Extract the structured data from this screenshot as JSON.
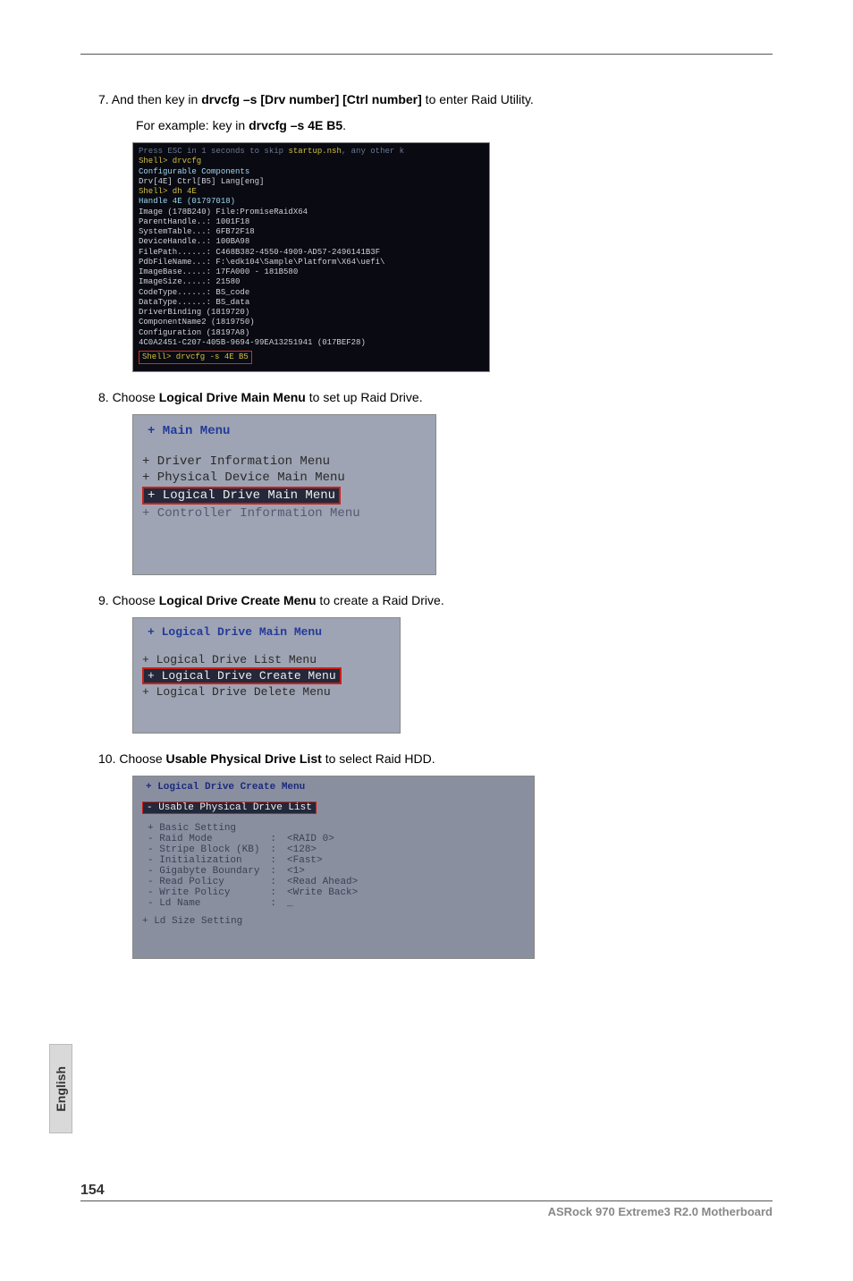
{
  "page": {
    "language_tab": "English",
    "number": "154",
    "footer_product": "ASRock  970 Extreme3 R2.0  Motherboard"
  },
  "step7": {
    "prefix": "7. And then key in ",
    "cmd_bold": "drvcfg –s [Drv number] [Ctrl number]",
    "suffix": " to enter Raid Utility.",
    "line2_prefix": "For example: key in ",
    "line2_bold": "drvcfg –s 4E B5",
    "line2_suffix": "."
  },
  "step8": {
    "prefix": "8. Choose ",
    "bold": "Logical Drive Main Menu",
    "suffix": " to set up Raid Drive."
  },
  "step9": {
    "prefix": "9. Choose ",
    "bold": "Logical Drive Create Menu",
    "suffix": " to create a Raid Drive."
  },
  "step10": {
    "prefix": "10. Choose ",
    "bold": "Usable Physical Drive List",
    "suffix": " to select Raid HDD."
  },
  "sshot1": {
    "l01a": "Press ESC in 1 seconds to skip ",
    "l01b": "startup.nsh",
    "l01c": ", any other k",
    "l02": "Shell> drvcfg",
    "l03": "Configurable Components",
    "l04": "  Drv[4E]  Ctrl[B5]  Lang[eng]",
    "l05": "",
    "l06": "Shell> dh 4E",
    "l07": "Handle 4E (01797018)",
    "l08": "    Image (178B240)   File:PromiseRaidX64",
    "l09": "      ParentHandle..: 1001F18",
    "l10": "      SystemTable...: 6FB72F18",
    "l11": "      DeviceHandle..: 100BA98",
    "l12": "      FilePath......: C468B382-4550-4909-AD57-2496141B3F",
    "l13": "      PdbFileName...: F:\\edk104\\Sample\\Platform\\X64\\uefi\\",
    "l14": "      ImageBase.....: 17FA000 - 181B580",
    "l15": "      ImageSize.....: 21580",
    "l16": "      CodeType......: BS_code",
    "l17": "      DataType......: BS_data",
    "l18": "   DriverBinding (1819720)",
    "l19": "   ComponentName2 (1819750)",
    "l20": "   Configuration (18197A8)",
    "l21": "   4C0A2451-C207-405B-9694-99EA13251941 (017BEF28)",
    "cmd_box": "Shell> drvcfg -s 4E B5"
  },
  "sshot2": {
    "title": "+ Main Menu",
    "r1": "+ Driver Information Menu",
    "r2": "+ Physical Device Main Menu",
    "r3": "+ Logical Drive Main Menu",
    "r4": "+ Controller Information Menu"
  },
  "sshot3": {
    "title": "+ Logical Drive Main Menu",
    "r1": "+ Logical Drive List Menu",
    "r2": "+ Logical Drive Create Menu",
    "r3": "+ Logical Drive Delete Menu"
  },
  "sshot4": {
    "title": "+ Logical Drive Create Menu",
    "hl": "- Usable Physical Drive List",
    "rows": [
      {
        "k": "+ Basic Setting",
        "c": "",
        "v": ""
      },
      {
        "k": "- Raid Mode",
        "c": ":",
        "v": "<RAID 0>"
      },
      {
        "k": "- Stripe Block (KB)",
        "c": ":",
        "v": "<128>"
      },
      {
        "k": "- Initialization",
        "c": ":",
        "v": "<Fast>"
      },
      {
        "k": "- Gigabyte Boundary",
        "c": ":",
        "v": "<1>"
      },
      {
        "k": "- Read Policy",
        "c": ":",
        "v": "<Read Ahead>"
      },
      {
        "k": "- Write Policy",
        "c": ":",
        "v": "<Write Back>"
      },
      {
        "k": "- Ld Name",
        "c": ":",
        "v": "_"
      }
    ],
    "last": "+ Ld Size Setting"
  }
}
